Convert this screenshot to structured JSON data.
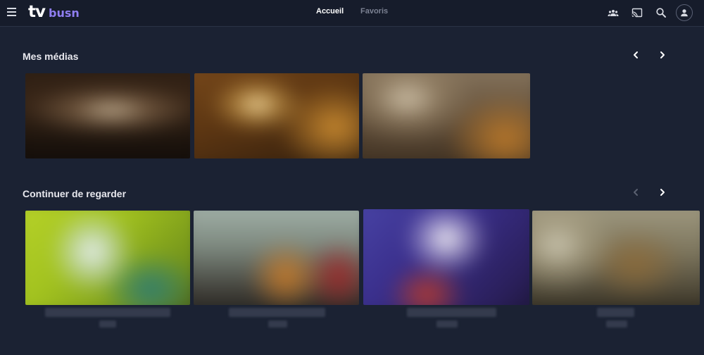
{
  "app": {
    "logo_main": "tv",
    "logo_brand": "busn"
  },
  "header": {
    "nav": [
      {
        "label": "Accueil",
        "active": true
      },
      {
        "label": "Favoris",
        "active": false
      }
    ],
    "icons": [
      "menu-icon",
      "group-icon",
      "cast-icon",
      "search-icon",
      "account-icon"
    ]
  },
  "sections": [
    {
      "title": "Mes médias",
      "prev_enabled": true,
      "next_enabled": true,
      "items": [
        {
          "thumbnail": "blurred"
        },
        {
          "thumbnail": "blurred"
        },
        {
          "thumbnail": "blurred"
        }
      ]
    },
    {
      "title": "Continuer de regarder",
      "prev_enabled": false,
      "next_enabled": true,
      "items": [
        {
          "thumbnail": "blurred"
        },
        {
          "thumbnail": "blurred"
        },
        {
          "thumbnail": "blurred"
        },
        {
          "thumbnail": "blurred"
        }
      ]
    }
  ],
  "colors": {
    "background": "#1b2233",
    "topbar": "#161c2b",
    "brand_accent": "#8f7ef0",
    "text_primary": "#ffffff",
    "text_muted": "#7c8293"
  }
}
